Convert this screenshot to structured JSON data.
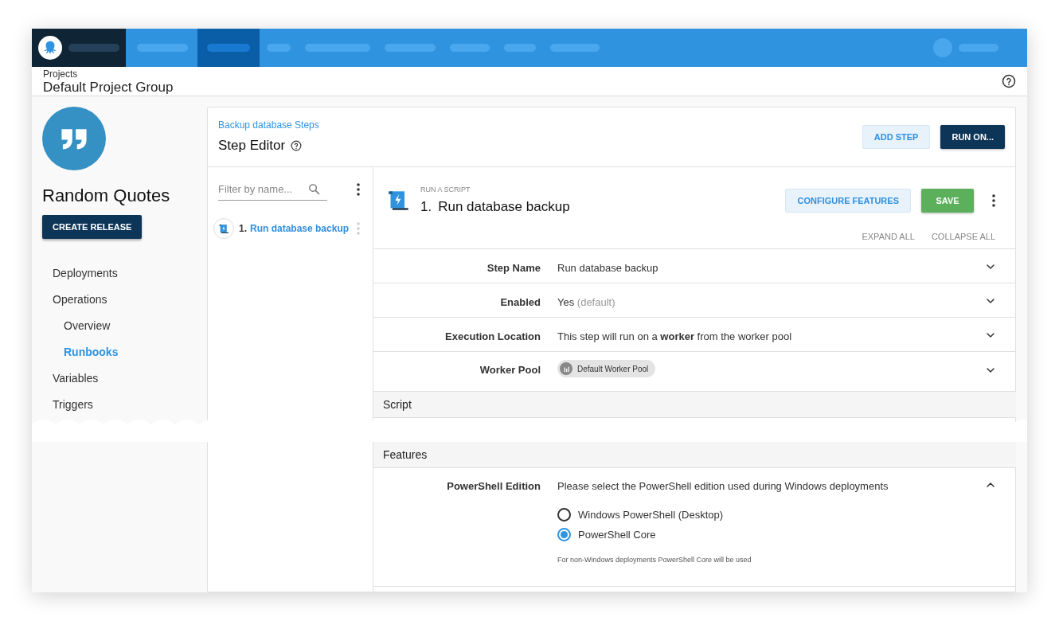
{
  "top_nav": {
    "items": [
      {
        "selected": false
      },
      {
        "selected": true
      },
      {
        "selected": false
      },
      {
        "selected": false
      },
      {
        "selected": false
      },
      {
        "selected": false
      },
      {
        "selected": false
      },
      {
        "selected": false
      }
    ]
  },
  "header": {
    "breadcrumb": "Projects",
    "title": "Default Project Group"
  },
  "sidebar": {
    "project_name": "Random Quotes",
    "create_button": "CREATE RELEASE",
    "items": [
      {
        "label": "Deployments",
        "selected": false
      },
      {
        "label": "Operations",
        "selected": false,
        "children": [
          {
            "label": "Overview",
            "selected": false
          },
          {
            "label": "Runbooks",
            "selected": true
          }
        ]
      },
      {
        "label": "Variables",
        "selected": false
      },
      {
        "label": "Triggers",
        "selected": false
      }
    ]
  },
  "step_editor": {
    "breadcrumb_link": "Backup database Steps",
    "title": "Step Editor",
    "buttons": [
      {
        "label": "ADD STEP",
        "kind": "secondary"
      },
      {
        "label": "RUN ON...",
        "kind": "primary"
      }
    ]
  },
  "step_list": {
    "filter_placeholder": "Filter by name...",
    "steps": [
      {
        "number": "1.",
        "name": "Run database backup"
      }
    ]
  },
  "step": {
    "type_label": "RUN A SCRIPT",
    "number": "1.",
    "title": "Run database backup",
    "actions": [
      {
        "label": "CONFIGURE FEATURES",
        "kind": "secondary"
      },
      {
        "label": "SAVE",
        "kind": "success"
      }
    ],
    "expand_all": "EXPAND ALL",
    "collapse_all": "COLLAPSE ALL",
    "fields": [
      {
        "label": "Step Name",
        "kind": "text",
        "value": "Run database backup",
        "expanded": false
      },
      {
        "label": "Enabled",
        "kind": "text",
        "value": "Yes",
        "hint": "(default)",
        "expanded": false
      },
      {
        "label": "Execution Location",
        "kind": "text",
        "value": "This step will run on a **worker** from the worker pool",
        "expanded": false
      },
      {
        "label": "Worker Pool",
        "kind": "chip",
        "value": "Default Worker Pool",
        "expanded": false
      }
    ],
    "sections": [
      {
        "title": "Script"
      },
      {
        "title": "Features",
        "fields": [
          {
            "label": "PowerShell Edition",
            "kind": "radio",
            "value": "Please select the PowerShell edition used during Windows deployments",
            "expanded": true,
            "options": [
              {
                "label": "Windows PowerShell (Desktop)",
                "selected": false
              },
              {
                "label": "PowerShell Core",
                "selected": true
              }
            ],
            "note": "For non-Windows deployments PowerShell Core will be used"
          }
        ]
      }
    ]
  }
}
